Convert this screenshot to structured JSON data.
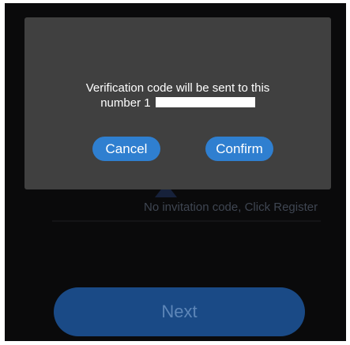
{
  "background": {
    "invitation_hint": "No invitation code, Click Register",
    "next_label": "Next"
  },
  "dialog": {
    "message_line1": "Verification code will be sent to this",
    "message_line2_prefix": "number 1",
    "cancel_label": "Cancel",
    "confirm_label": "Confirm"
  },
  "colors": {
    "dialog_bg": "#404040",
    "button_blue": "#2f7fd0",
    "next_button_dim": "#1a4a86",
    "screen_bg": "#0a0a0b"
  }
}
